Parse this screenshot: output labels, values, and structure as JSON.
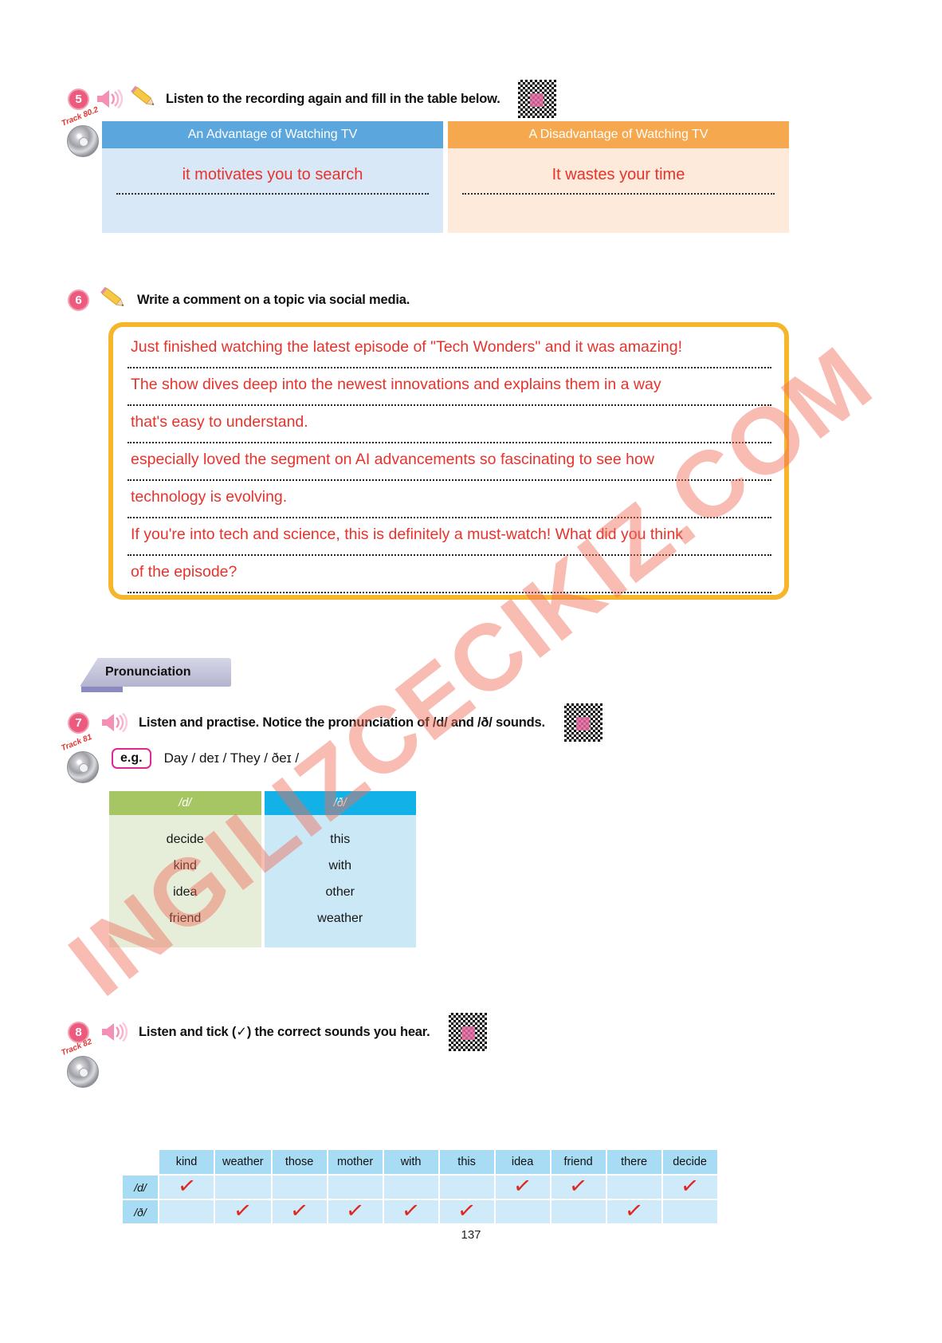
{
  "page": {
    "number": "137"
  },
  "watermark": {
    "text": "INGILIZCECIKIZ.COM"
  },
  "exercise5": {
    "number": "5",
    "instruction": "Listen to the recording again and fill in the table below.",
    "track": "Track 80.2",
    "speaker_icon": "speaker-icon",
    "pencil_icon": "pencil-icon",
    "qr_icon": "qr-code-icon",
    "table": {
      "headers": [
        "An Advantage of Watching TV",
        "A Disadvantage of Watching TV"
      ],
      "answers": [
        "it motivates you to search",
        "It wastes your time"
      ],
      "header_colors": [
        "#5ba7dd",
        "#f5a84d"
      ],
      "body_colors": [
        "#d9e8f7",
        "#fdeada"
      ]
    }
  },
  "exercise6": {
    "number": "6",
    "instruction": "Write a comment on a topic via social media.",
    "pencil_icon": "pencil-icon",
    "border_color": "#f6b62c",
    "answer_lines": [
      "Just finished watching the latest episode of \"Tech Wonders\" and it was amazing!",
      " The show dives deep into the newest innovations and explains them in a way",
      " that's easy to understand.",
      "especially loved the segment on AI advancements so fascinating to see how",
      "technology is evolving.",
      "If you're into tech and science, this is definitely a must-watch! What did you think",
      "of the episode?"
    ]
  },
  "pronunciation_section": {
    "tab_label": "Pronunciation"
  },
  "exercise7": {
    "number": "7",
    "instruction": "Listen and practise. Notice the pronunciation of /d/ and /ð/ sounds.",
    "track": "Track 81",
    "speaker_icon": "speaker-icon",
    "qr_icon": "qr-code-icon",
    "example_chip": "e.g.",
    "example_text": "Day / deɪ / They / ðeɪ /",
    "table": {
      "headers": [
        "/d/",
        "/ð/"
      ],
      "header_colors": [
        "#a5c663",
        "#12b2e8"
      ],
      "body_colors": [
        "#e6eeda",
        "#cbe8f7"
      ],
      "columns": [
        [
          "decide",
          "kind",
          "idea",
          "friend"
        ],
        [
          "this",
          "with",
          "other",
          "weather"
        ]
      ]
    }
  },
  "exercise8": {
    "number": "8",
    "instruction": "Listen and tick (✓) the correct sounds you hear.",
    "track": "Track 82",
    "speaker_icon": "speaker-icon",
    "qr_icon": "qr-code-icon",
    "table": {
      "columns": [
        "kind",
        "weather",
        "those",
        "mother",
        "with",
        "this",
        "idea",
        "friend",
        "there",
        "decide"
      ],
      "rows": [
        {
          "label": "/d/",
          "ticks": [
            true,
            false,
            false,
            false,
            false,
            false,
            true,
            true,
            false,
            true
          ]
        },
        {
          "label": "/ð/",
          "ticks": [
            false,
            true,
            true,
            true,
            true,
            true,
            false,
            false,
            true,
            false
          ]
        }
      ],
      "tick_glyph": "✓",
      "tick_color": "#e0261f"
    }
  }
}
